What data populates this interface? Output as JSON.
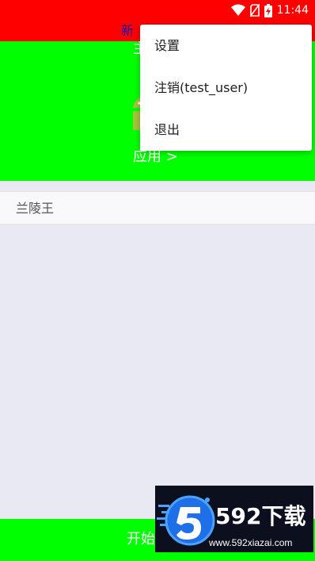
{
  "status_bar": {
    "time": "11:44",
    "icons": [
      "wifi-icon",
      "no-sim-icon",
      "battery-charging-icon"
    ],
    "color": "#ff0000"
  },
  "header": {
    "title": "新"
  },
  "panel": {
    "sub_label": "主",
    "apps_link": "应用 >",
    "color": "#00ff00"
  },
  "list": {
    "items": [
      {
        "label": "兰陵王"
      }
    ]
  },
  "bottom_button": {
    "label": "开始"
  },
  "menu": {
    "items": [
      {
        "label": "设置"
      },
      {
        "label": "注销(test_user)"
      },
      {
        "label": "退出"
      }
    ]
  },
  "watermark": {
    "logo_text": "592下载",
    "url": "www.592xiazai.com"
  }
}
